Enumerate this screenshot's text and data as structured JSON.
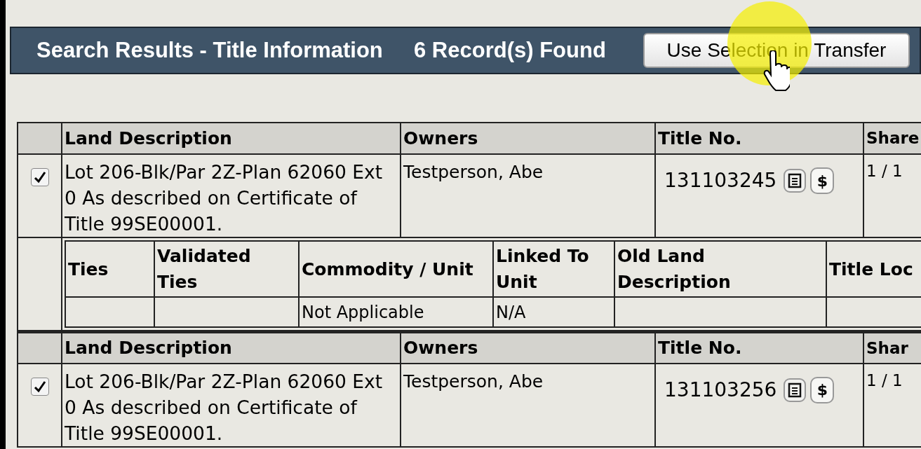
{
  "header": {
    "title": "Search Results - Title Information",
    "count": "6 Record(s) Found",
    "button": "Use Selection in Transfer"
  },
  "records": [
    {
      "columns": [
        "Land Description",
        "Owners",
        "Title No.",
        "Share"
      ],
      "checked": true,
      "land_description": "Lot 206-Blk/Par 2Z-Plan 62060 Ext 0 As described on Certificate of Title 99SE00001.",
      "owners": "Testperson, Abe",
      "title_no": "131103245",
      "price_button": "$",
      "share": "1 / 1",
      "details": {
        "columns": [
          {
            "label": "Ties"
          },
          {
            "label": "Validated Ties"
          },
          {
            "label": "Commodity / Unit",
            "value": "Not Applicable"
          },
          {
            "label": "Linked To Unit",
            "value": "N/A"
          },
          {
            "label": "Old Land Description"
          },
          {
            "label": "Title Loc"
          }
        ]
      }
    },
    {
      "columns": [
        "Land Description",
        "Owners",
        "Title No.",
        "Shar"
      ],
      "checked": true,
      "land_description": "Lot 206-Blk/Par 2Z-Plan 62060 Ext 0 As described on Certificate of Title 99SE00001.",
      "owners": "Testperson, Abe",
      "title_no": "131103256",
      "price_button": "$",
      "share": "1 / 1"
    }
  ]
}
